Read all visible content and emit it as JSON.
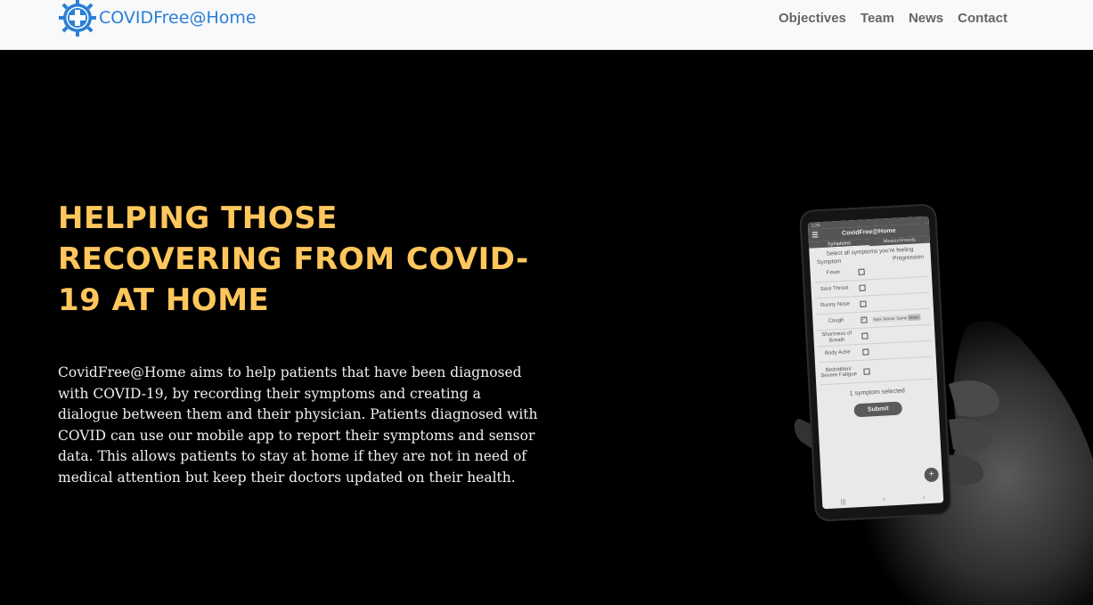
{
  "navbar": {
    "brand": "COVIDFree@Home",
    "links": [
      "Objectives",
      "Team",
      "News",
      "Contact"
    ]
  },
  "hero": {
    "headline": "HELPING THOSE RECOVERING FROM COVID-19 AT HOME",
    "description": "CovidFree@Home aims to help patients that have been diagnosed with COVID-19, by recording their symptoms and creating a dialogue between them and their physician. Patients diagnosed with COVID can use our mobile app to report their symptoms and sensor data. This allows patients to stay at home if they are not in need of medical attention but keep their doctors updated on their health."
  },
  "phone": {
    "status_time": "1:26",
    "app_title": "CovidFree@Home",
    "menu_icon": "hamburger-icon",
    "tabs": [
      "Symptoms",
      "Measurements"
    ],
    "instruction": "Select all symptoms you're feeling",
    "col_symptom": "Symptom",
    "col_progression": "Progression",
    "symptoms": [
      "Fever",
      "Sore Throat",
      "Runny Nose",
      "Cough",
      "Shortness of Breath",
      "Body Ache",
      "Bedridden/ Severe Fatigue"
    ],
    "progression_options": [
      "New",
      "Worse",
      "Same",
      "Better"
    ],
    "selected_count": "1 symptom selected",
    "submit": "Submit",
    "fab": "+",
    "softkeys": [
      "|||",
      "○",
      "‹"
    ]
  },
  "colors": {
    "brand_blue": "#2b7ed6",
    "headline_yellow": "#ffc65c",
    "hero_bg": "#000000",
    "nav_bg": "#f8f9fa"
  }
}
